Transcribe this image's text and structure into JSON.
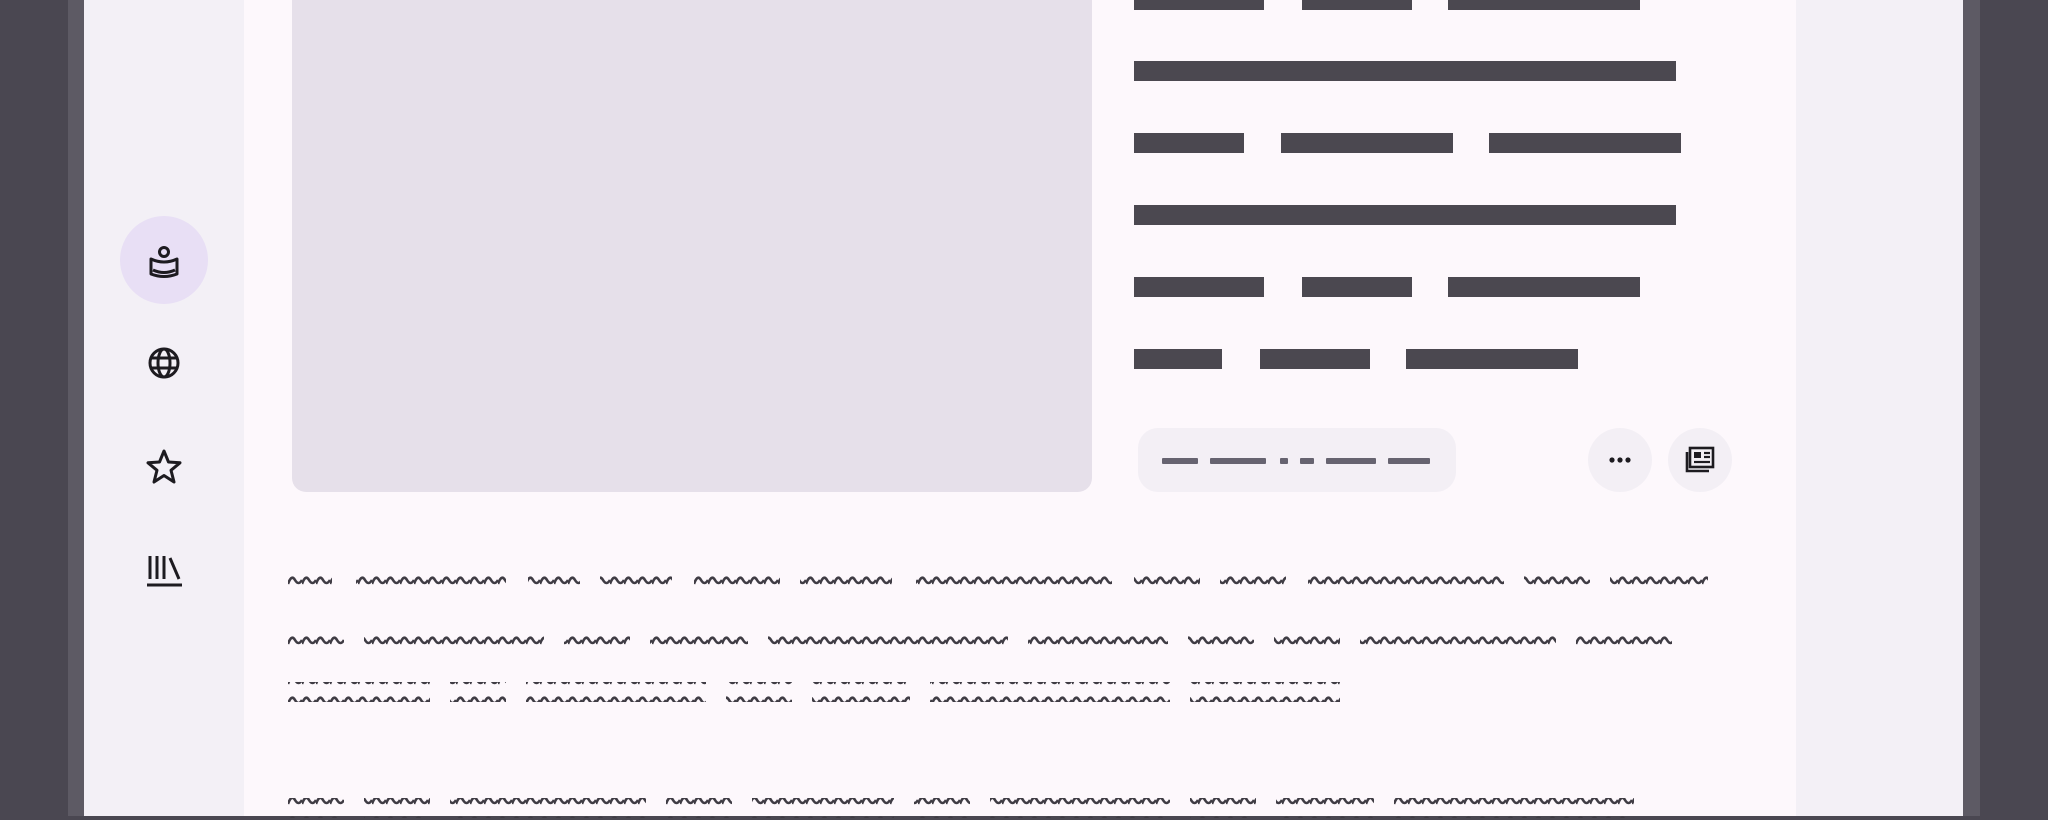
{
  "rail": {
    "items": [
      {
        "icon": "person-badge-icon",
        "active": true
      },
      {
        "icon": "globe-icon",
        "active": false
      },
      {
        "icon": "star-icon",
        "active": false
      },
      {
        "icon": "library-icon",
        "active": false
      }
    ]
  },
  "article": {
    "meta_actions": [
      {
        "icon": "more-horiz-icon"
      },
      {
        "icon": "newspaper-icon"
      }
    ]
  },
  "colors": {
    "background": "#4a4751",
    "rail": "#f3f0f6",
    "panel": "#fdf8fc",
    "active_pill": "#e8dff5",
    "placeholder_image": "#e6e0ea",
    "text_redacted": "#4b4850"
  }
}
